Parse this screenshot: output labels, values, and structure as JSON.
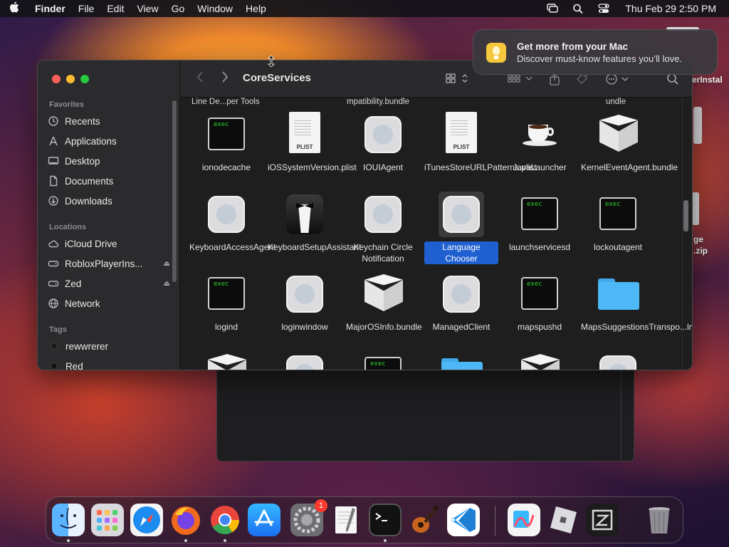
{
  "menubar": {
    "app_name": "Finder",
    "menus": [
      "File",
      "Edit",
      "View",
      "Go",
      "Window",
      "Help"
    ],
    "clock": "Thu Feb 29  2:50 PM",
    "icons": [
      "apple-icon",
      "screen-mirroring-icon",
      "spotlight-icon",
      "control-center-icon"
    ]
  },
  "desktop": {
    "partial_labels": [
      "erInstal",
      "ge",
      ".zip"
    ]
  },
  "notification": {
    "title": "Get more from your Mac",
    "body": "Discover must-know features you’ll love.",
    "icon": "lightbulb-icon",
    "icon_color": "#f5c73c"
  },
  "finder": {
    "title": "CoreServices",
    "sidebar": {
      "favorites_header": "Favorites",
      "favorites": [
        {
          "label": "Recents",
          "icon": "clock-icon"
        },
        {
          "label": "Applications",
          "icon": "applications-icon"
        },
        {
          "label": "Desktop",
          "icon": "desktop-icon"
        },
        {
          "label": "Documents",
          "icon": "document-icon"
        },
        {
          "label": "Downloads",
          "icon": "download-icon"
        }
      ],
      "locations_header": "Locations",
      "locations": [
        {
          "label": "iCloud Drive",
          "icon": "cloud-icon"
        },
        {
          "label": "RobloxPlayerIns...",
          "icon": "disk-icon",
          "eject": "⏏"
        },
        {
          "label": "Zed",
          "icon": "disk-icon",
          "eject": "⏏"
        },
        {
          "label": "Network",
          "icon": "globe-icon"
        }
      ],
      "tags_header": "Tags",
      "tags": [
        {
          "label": "rewwrerer"
        },
        {
          "label": "Red"
        }
      ]
    },
    "cut_labels": [
      "Line De...per Tools",
      "mpatibility.bundle",
      "undle"
    ],
    "files": [
      {
        "label": "ionodecache",
        "icon": "exec"
      },
      {
        "label": "iOSSystemVersion.plist",
        "icon": "plist"
      },
      {
        "label": "IOUIAgent",
        "icon": "app"
      },
      {
        "label": "iTunesStoreURLPatterns.plist",
        "icon": "plist"
      },
      {
        "label": "JavaLauncher",
        "icon": "coffee"
      },
      {
        "label": "KernelEventAgent.bundle",
        "icon": "bundle"
      },
      {
        "label": "KeyboardAccessAgent",
        "icon": "app"
      },
      {
        "label": "KeyboardSetupAssistant",
        "icon": "tuxedo"
      },
      {
        "label": "Keychain Circle Notification",
        "icon": "app"
      },
      {
        "label": "Language Chooser",
        "icon": "app",
        "selected": true
      },
      {
        "label": "launchservicesd",
        "icon": "exec"
      },
      {
        "label": "lockoutagent",
        "icon": "exec"
      },
      {
        "label": "logind",
        "icon": "exec"
      },
      {
        "label": "loginwindow",
        "icon": "app"
      },
      {
        "label": "MajorOSInfo.bundle",
        "icon": "bundle"
      },
      {
        "label": "ManagedClient",
        "icon": "app"
      },
      {
        "label": "mapspushd",
        "icon": "exec"
      },
      {
        "label": "MapsSuggestionsTranspo...lmodelc",
        "icon": "folder"
      }
    ],
    "exec_text": "exec",
    "plist_text": "PLIST"
  },
  "dock": {
    "apps": [
      {
        "name": "Finder",
        "icon": "finder-icon",
        "color": "#2e8ff0"
      },
      {
        "name": "Launchpad",
        "icon": "launchpad-icon",
        "color": "#d8d8dc"
      },
      {
        "name": "Safari",
        "icon": "safari-icon",
        "color": "#1d8cf0"
      },
      {
        "name": "Firefox",
        "icon": "firefox-icon",
        "color": "#f06a1e"
      },
      {
        "name": "Chrome",
        "icon": "chrome-icon",
        "color": "#e8e8e8"
      },
      {
        "name": "App Store",
        "icon": "app-store-icon",
        "color": "#1b8af2"
      },
      {
        "name": "System Settings",
        "icon": "gear-icon",
        "color": "#8a8a8e",
        "badge": "1"
      },
      {
        "name": "TextEdit",
        "icon": "textedit-icon",
        "color": "#f0f0f0"
      },
      {
        "name": "Terminal",
        "icon": "terminal-icon",
        "color": "#1a1a1a"
      },
      {
        "name": "GarageBand",
        "icon": "guitar-icon",
        "color": "#c8641e"
      },
      {
        "name": "VS Code",
        "icon": "vscode-icon",
        "color": "#ffffff"
      },
      {
        "name": "Freeform",
        "icon": "freeform-icon",
        "color": "#f4f4f4"
      },
      {
        "name": "Roblox",
        "icon": "roblox-icon",
        "color": "#d8d8dc"
      },
      {
        "name": "Zed",
        "icon": "zed-icon",
        "color": "#1c1c1c"
      },
      {
        "name": "Trash",
        "icon": "trash-icon",
        "color": "#9a9aa0"
      }
    ]
  }
}
